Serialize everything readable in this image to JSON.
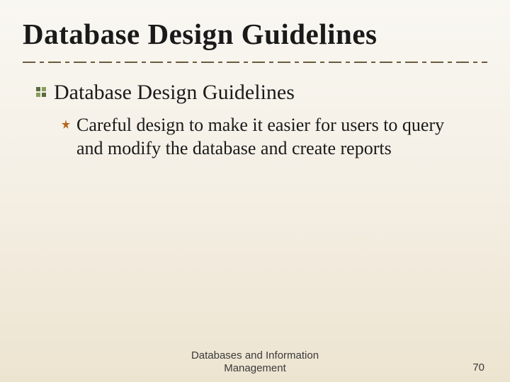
{
  "title": "Database Design Guidelines",
  "bullets": {
    "l1": {
      "text": "Database Design Guidelines"
    },
    "l2": {
      "text": "Careful design to make it easier for users to query and modify the database and create reports"
    }
  },
  "footer": {
    "center": "Databases and Information Management",
    "page": "70"
  },
  "colors": {
    "bullet1": "#5a6b3f",
    "bullet2": "#b5651d"
  }
}
